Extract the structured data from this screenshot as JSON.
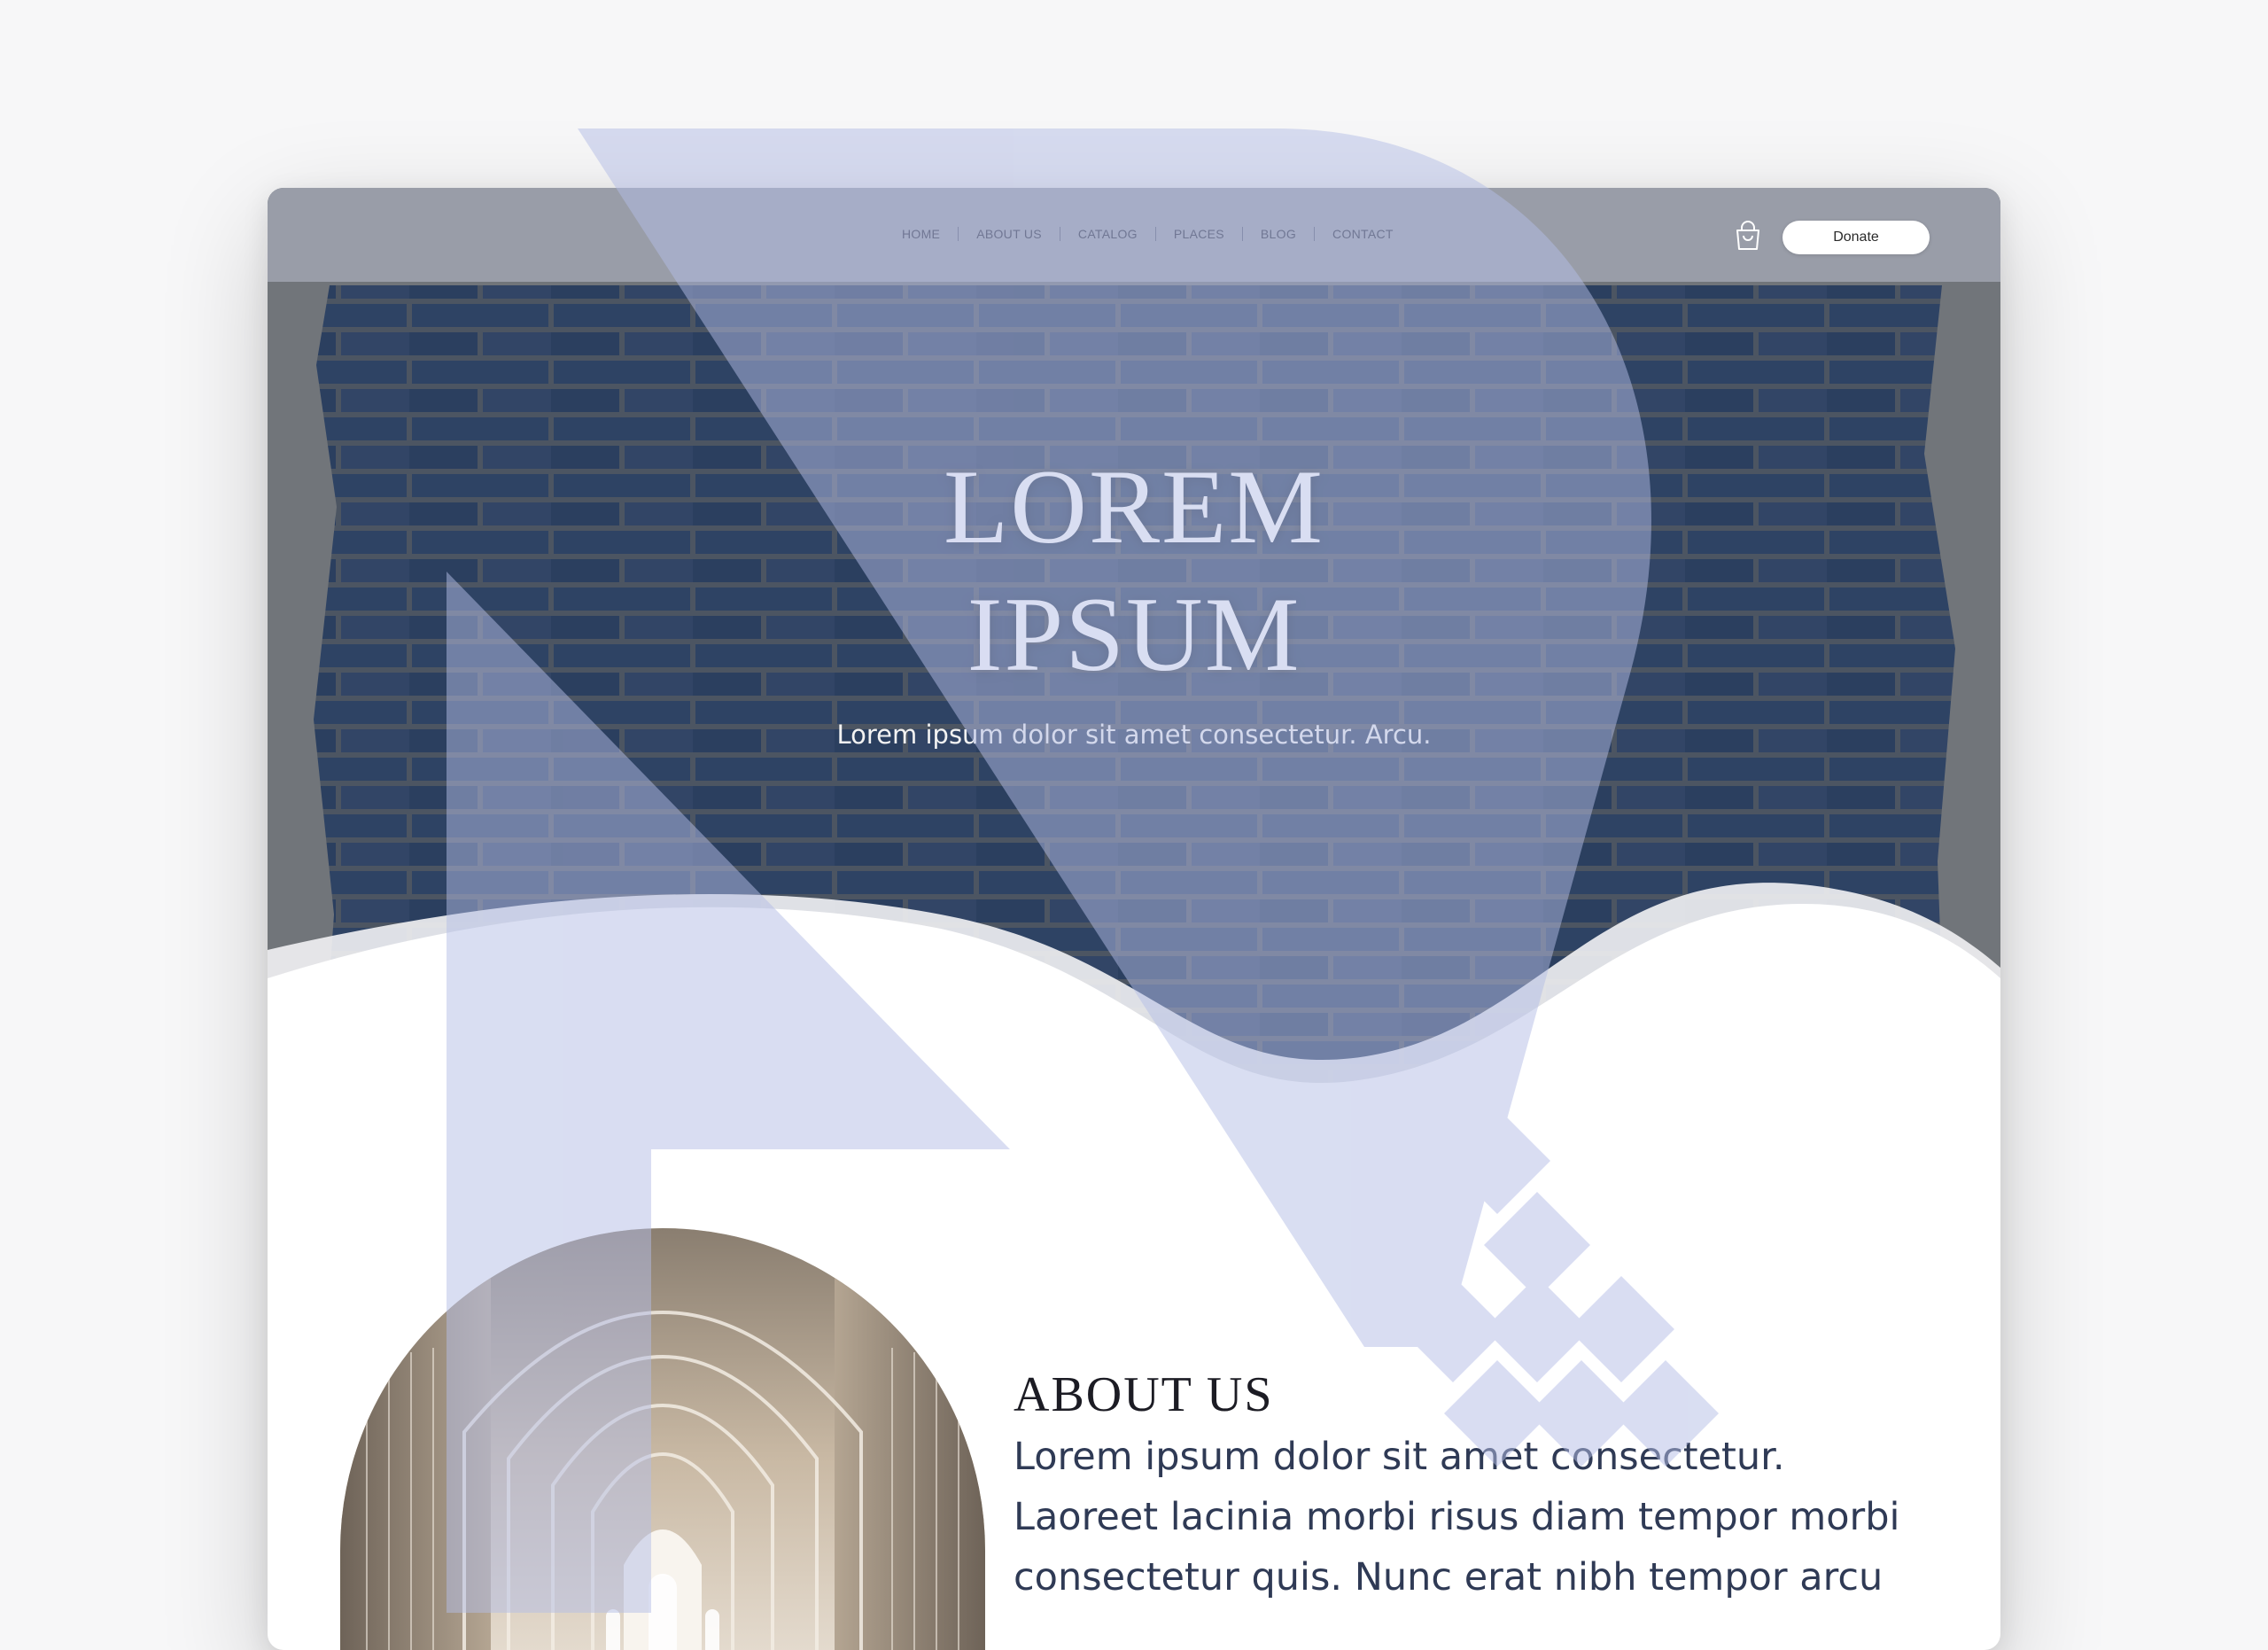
{
  "nav": {
    "items": [
      {
        "label": "HOME"
      },
      {
        "label": "ABOUT US"
      },
      {
        "label": "CATALOG"
      },
      {
        "label": "PLACES"
      },
      {
        "label": "BLOG"
      },
      {
        "label": "CONTACT"
      }
    ],
    "cart_icon": "shopping-bag-icon",
    "donate_label": "Donate"
  },
  "hero": {
    "title_line1": "LOREM",
    "title_line2": "IPSUM",
    "subtitle": "Lorem ipsum dolor sit amet consectetur. Arcu."
  },
  "about": {
    "heading": "ABOUT US",
    "body": "Lorem ipsum dolor sit amet consectetur. Laoreet lacinia morbi risus diam tempor morbi consectetur quis. Nunc erat nibh tempor arcu"
  },
  "colors": {
    "accent": "#c5cbe6",
    "brick_blue": "#33476b",
    "text_dark": "#2f3a55"
  }
}
